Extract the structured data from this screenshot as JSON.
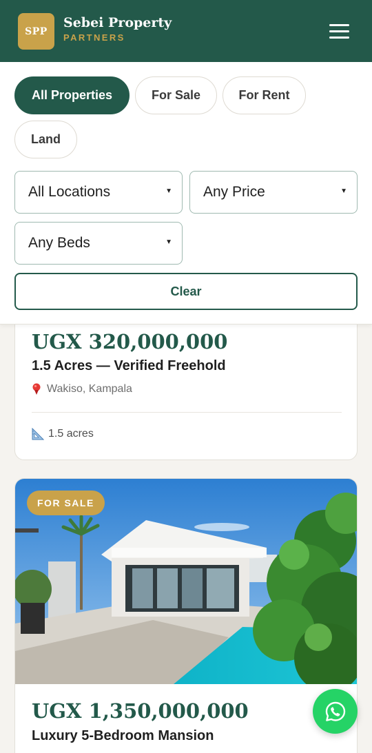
{
  "header": {
    "logo_text": "SPP",
    "brand_name": "Sebei Property",
    "brand_sub": "PARTNERS",
    "menu_icon": "hamburger-menu-icon"
  },
  "filters": {
    "tabs": [
      {
        "label": "All Properties",
        "active": true
      },
      {
        "label": "For Sale",
        "active": false
      },
      {
        "label": "For Rent",
        "active": false
      },
      {
        "label": "Land",
        "active": false
      }
    ],
    "location": {
      "selected": "All Locations"
    },
    "price": {
      "selected": "Any Price"
    },
    "beds": {
      "selected": "Any Beds"
    },
    "clear_label": "Clear"
  },
  "listings": [
    {
      "price": "UGX 320,000,000",
      "title": "1.5 Acres — Verified Freehold",
      "location": "Wakiso, Kampala",
      "location_icon": "map-pin-icon",
      "feature": "1.5 acres",
      "feature_icon": "ruler-triangle-icon"
    },
    {
      "badge": "FOR SALE",
      "price": "UGX 1,350,000,000",
      "title": "Luxury 5-Bedroom Mansion",
      "image_icon": "modern-villa-with-pool-photo"
    }
  ],
  "colors": {
    "primary": "#23594a",
    "accent": "#c9a24a",
    "whatsapp": "#25d366"
  },
  "fab": {
    "icon": "whatsapp-icon"
  }
}
